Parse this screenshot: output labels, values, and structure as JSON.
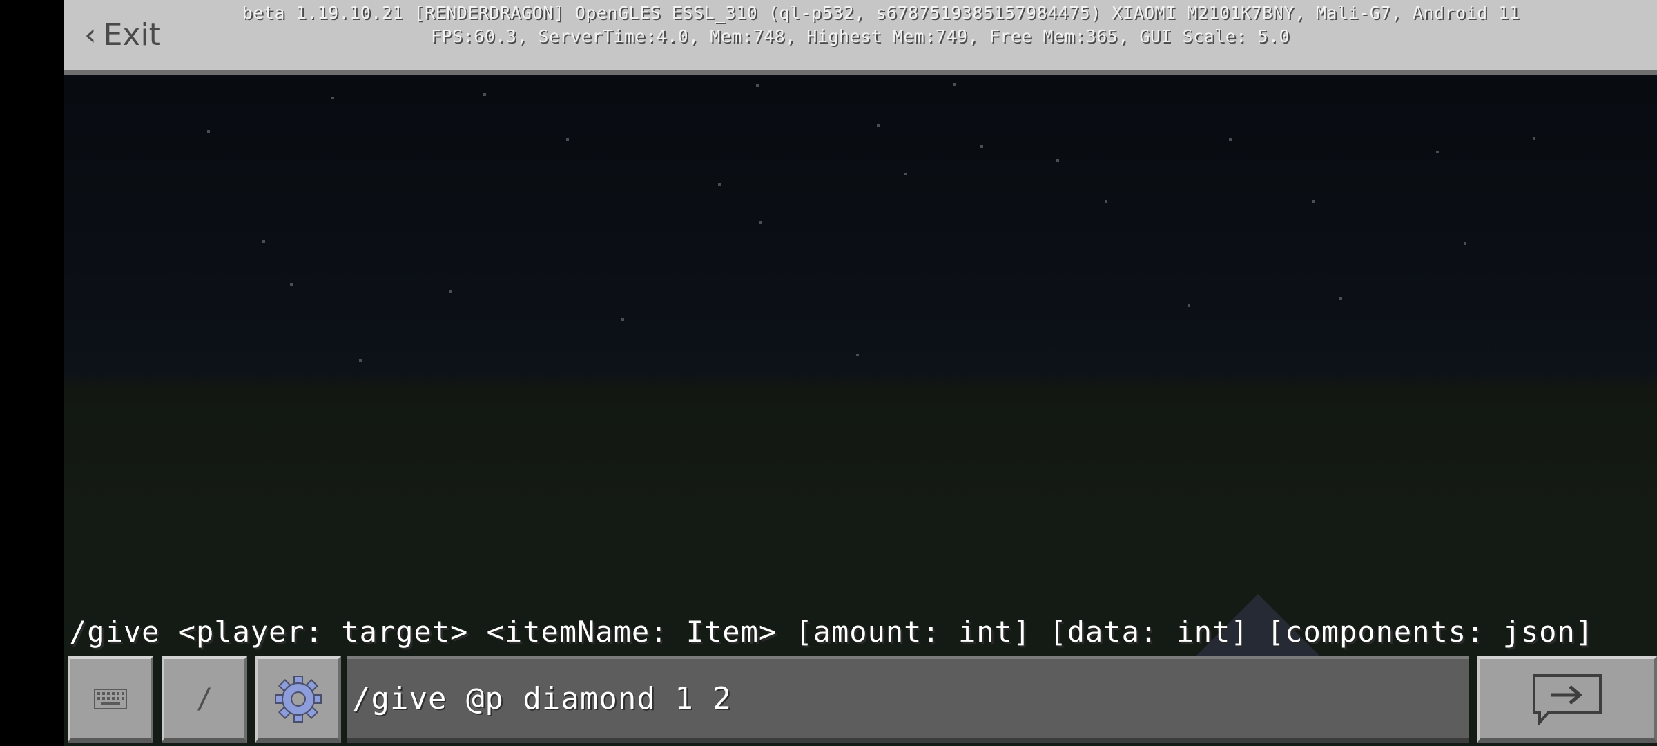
{
  "topbar": {
    "exit_label": "Exit",
    "debug_line_1": "beta 1.19.10.21 [RENDERDRAGON] OpenGLES ESSL_310 (ql-p532, s6787519385157984475) XIAOMI M2101K7BNY, Mali-G7, Android 11",
    "debug_line_2": "FPS:60.3, ServerTime:4.0, Mem:748, Highest Mem:749, Free Mem:365, GUI Scale: 5.0"
  },
  "chat": {
    "usage_hint": "/give <player: target> <itemName: Item> [amount: int] [data: int] [components: json]",
    "input_value": "/give @p diamond 1 2",
    "slash_label": "/"
  },
  "icons": {
    "keyboard": "keyboard-icon",
    "settings": "gear-icon",
    "send": "send-arrow-icon"
  },
  "colors": {
    "topbar": "#c6c6c6",
    "input_bg": "#5d5d5d",
    "button_bg": "#a0a0a0",
    "gear_accent": "#8d9ddc"
  }
}
